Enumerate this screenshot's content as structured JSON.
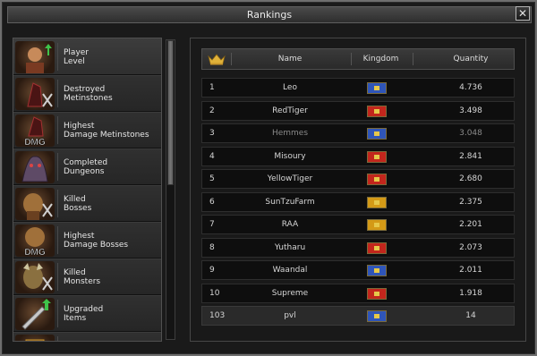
{
  "window": {
    "title": "Rankings",
    "close_glyph": "✕"
  },
  "categories": [
    {
      "line1": "Player",
      "line2": "Level",
      "icon": "player-portrait-icon"
    },
    {
      "line1": "Destroyed",
      "line2": "Metinstones",
      "icon": "metinstone-icon"
    },
    {
      "line1": "Highest",
      "line2": "Damage Metinstones",
      "icon": "dmg-metinstone-icon",
      "badge": "DMG"
    },
    {
      "line1": "Completed",
      "line2": "Dungeons",
      "icon": "dungeon-icon"
    },
    {
      "line1": "Killed",
      "line2": "Bosses",
      "icon": "boss-icon"
    },
    {
      "line1": "Highest",
      "line2": "Damage Bosses",
      "icon": "dmg-boss-icon",
      "badge": "DMG"
    },
    {
      "line1": "Killed",
      "line2": "Monsters",
      "icon": "monster-icon"
    },
    {
      "line1": "Upgraded",
      "line2": "Items",
      "icon": "upgrade-item-icon"
    },
    {
      "line1": "",
      "line2": "",
      "icon": "chest-icon"
    }
  ],
  "table": {
    "headers": {
      "name": "Name",
      "kingdom": "Kingdom",
      "quantity": "Quantity"
    },
    "rows": [
      {
        "rank": "1",
        "name": "Leo",
        "kingdom": "blue",
        "quantity": "4.736"
      },
      {
        "rank": "2",
        "name": "RedTiger",
        "kingdom": "red",
        "quantity": "3.498"
      },
      {
        "rank": "3",
        "name": "Hemmes",
        "kingdom": "blue",
        "quantity": "3.048"
      },
      {
        "rank": "4",
        "name": "Misoury",
        "kingdom": "red",
        "quantity": "2.841"
      },
      {
        "rank": "5",
        "name": "YellowTiger",
        "kingdom": "red",
        "quantity": "2.680"
      },
      {
        "rank": "6",
        "name": "SunTzuFarm",
        "kingdom": "yellow",
        "quantity": "2.375"
      },
      {
        "rank": "7",
        "name": "RAA",
        "kingdom": "yellow",
        "quantity": "2.201"
      },
      {
        "rank": "8",
        "name": "Yutharu",
        "kingdom": "red",
        "quantity": "2.073"
      },
      {
        "rank": "9",
        "name": "Waandal",
        "kingdom": "blue",
        "quantity": "2.011"
      },
      {
        "rank": "10",
        "name": "Supreme",
        "kingdom": "red",
        "quantity": "1.918"
      }
    ],
    "own_row": {
      "rank": "103",
      "name": "pvl",
      "kingdom": "blue",
      "quantity": "14"
    }
  },
  "colors": {
    "blue": "#2f55b8",
    "red": "#c2261c",
    "yellow": "#d49a16",
    "text": "#d6d6d6",
    "muted_name": "#8a8a8a"
  }
}
